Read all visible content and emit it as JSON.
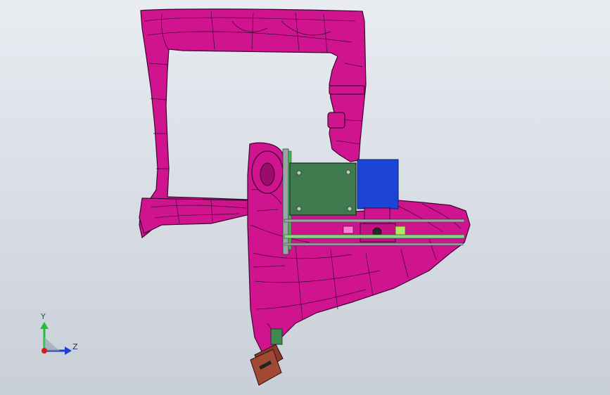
{
  "viewport": {
    "background_top": "#e9ecf1",
    "background_bottom": "#c9cfd8"
  },
  "model": {
    "frame_color": "#d0148f",
    "edge_color": "#3a0630",
    "board_color": "#3f7a4e",
    "block_color": "#1c44d6",
    "bracket_color": "#8a3b2a",
    "rail_color": "#9aa4a8"
  },
  "triad": {
    "y_label": "Y",
    "z_label": "Z",
    "y_color": "#22c03a",
    "z_color": "#1f3fd0",
    "x_color": "#d21b1b"
  }
}
